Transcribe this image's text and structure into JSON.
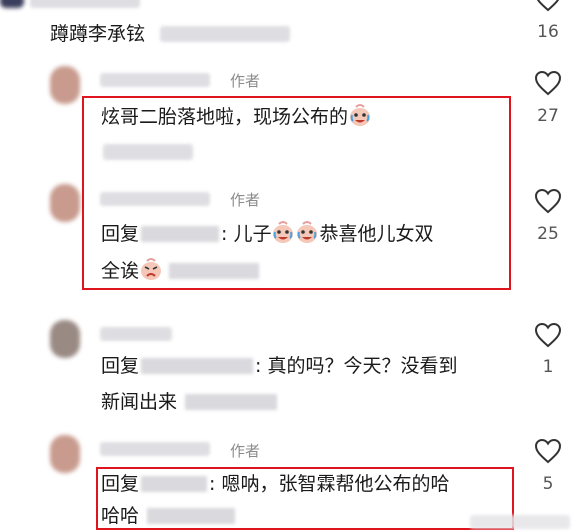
{
  "comments": [
    {
      "text": "蹲蹲李承铉",
      "likes": "16"
    },
    {
      "author_badge": "作者",
      "text": "炫哥二胎落地啦，现场公布的",
      "likes": "27"
    },
    {
      "author_badge": "作者",
      "reply_prefix": "回复",
      "text_a": ": 儿子",
      "text_b": "恭喜他儿女双",
      "text_c": "全诶",
      "likes": "25"
    },
    {
      "reply_prefix": "回复",
      "text_a": ": 真的吗？今天？没看到",
      "text_b": "新闻出来",
      "likes": "1"
    },
    {
      "author_badge": "作者",
      "reply_prefix": "回复",
      "text_a": ": 嗯呐，张智霖帮他公布的哈",
      "text_b": "哈哈",
      "likes": "5"
    }
  ],
  "icons": {
    "like": "heart-outline-icon",
    "emoji": "crying-laughing-emoji-icon"
  },
  "colors": {
    "highlight_box": "#e0141e",
    "blurred": "#d9d9de",
    "muted_text": "#8c8c8c"
  }
}
